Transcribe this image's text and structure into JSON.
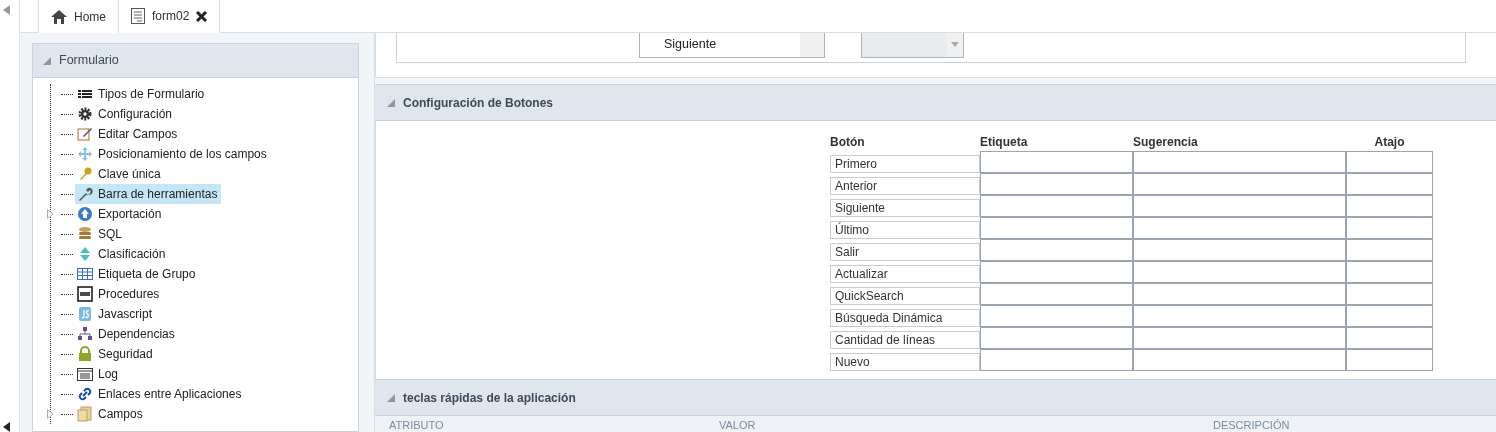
{
  "tabs": [
    {
      "label": "Home",
      "selected": false,
      "closable": false
    },
    {
      "label": "form02",
      "selected": true,
      "closable": true
    }
  ],
  "sidebar": {
    "title": "Formulario",
    "items": [
      {
        "label": "Tipos de Formulario",
        "selected": false,
        "expandable": false
      },
      {
        "label": "Configuración",
        "selected": false,
        "expandable": false
      },
      {
        "label": "Editar Campos",
        "selected": false,
        "expandable": false
      },
      {
        "label": "Posicionamiento de los campos",
        "selected": false,
        "expandable": false
      },
      {
        "label": "Clave única",
        "selected": false,
        "expandable": false
      },
      {
        "label": "Barra de herramientas",
        "selected": true,
        "expandable": false
      },
      {
        "label": "Exportación",
        "selected": false,
        "expandable": true
      },
      {
        "label": "SQL",
        "selected": false,
        "expandable": false
      },
      {
        "label": "Clasificación",
        "selected": false,
        "expandable": false
      },
      {
        "label": "Etiqueta de Grupo",
        "selected": false,
        "expandable": false
      },
      {
        "label": "Procedures",
        "selected": false,
        "expandable": false
      },
      {
        "label": "Javascript",
        "selected": false,
        "expandable": false
      },
      {
        "label": "Dependencias",
        "selected": false,
        "expandable": false
      },
      {
        "label": "Seguridad",
        "selected": false,
        "expandable": false
      },
      {
        "label": "Log",
        "selected": false,
        "expandable": false
      },
      {
        "label": "Enlaces entre Aplicaciones",
        "selected": false,
        "expandable": false
      },
      {
        "label": "Campos",
        "selected": false,
        "expandable": true
      }
    ]
  },
  "top_selects": [
    {
      "value": "Siguiente",
      "disabled": false
    },
    {
      "disabled": true
    }
  ],
  "buttons_section": {
    "title": "Configuración de Botones",
    "columns": [
      "Botón",
      "Etiqueta",
      "Sugerencia",
      "Atajo"
    ],
    "rows": [
      "Primero",
      "Anterior",
      "Siguiente",
      "Último",
      "Salir",
      "Actualizar",
      "QuickSearch",
      "Búsqueda Dinámica",
      "Cantidad de líneas",
      "Nuevo"
    ]
  },
  "shortcuts_section": {
    "title": "teclas rápidas de la aplicación",
    "columns": [
      "ATRIBUTO",
      "VALOR",
      "DESCRIPCIÓN"
    ]
  }
}
